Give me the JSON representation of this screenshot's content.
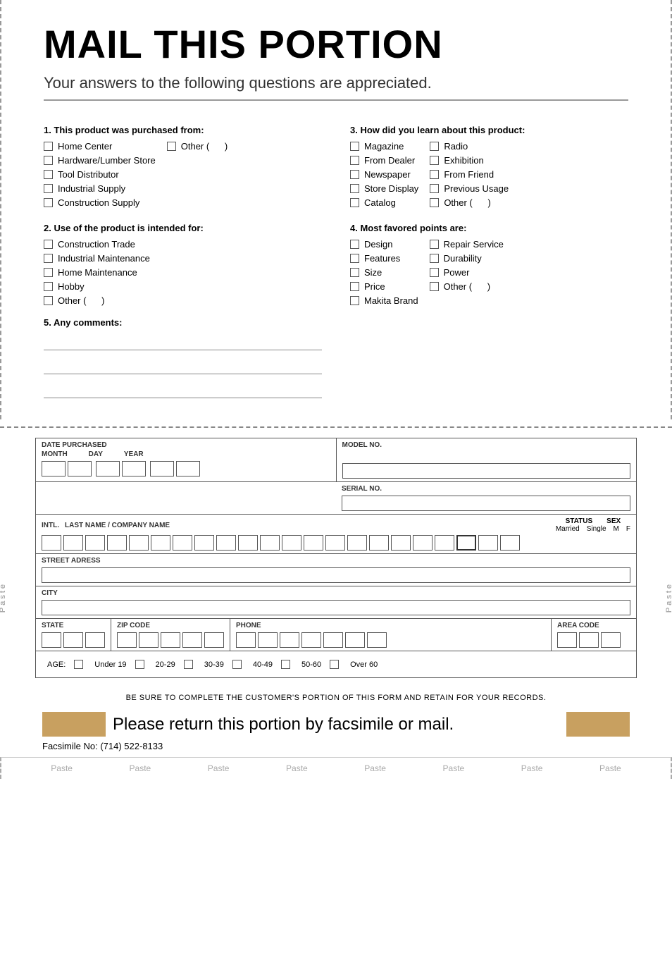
{
  "header": {
    "title": "MAIL THIS PORTION",
    "subtitle": "Your answers to the following questions are appreciated."
  },
  "q1": {
    "label": "1. This product was purchased from:",
    "items": [
      "Home Center",
      "Hardware/Lumber Store",
      "Tool Distributor",
      "Industrial Supply",
      "Construction Supply"
    ],
    "other_label": "Other (",
    "other_close": ")"
  },
  "q2": {
    "label": "2. Use of the product is intended for:",
    "items": [
      "Construction Trade",
      "Industrial Maintenance",
      "Home Maintenance",
      "Hobby",
      "Other ("
    ],
    "other_close": ")"
  },
  "q3": {
    "label": "3. How did you learn about this product:",
    "col1": [
      "Magazine",
      "From Dealer",
      "Newspaper",
      "Store Display",
      "Catalog"
    ],
    "col2": [
      "Radio",
      "Exhibition",
      "From Friend",
      "Previous Usage",
      "Other ("
    ],
    "other_close": ")"
  },
  "q4": {
    "label": "4. Most favored points are:",
    "col1": [
      "Design",
      "Features",
      "Size",
      "Price",
      "Makita Brand"
    ],
    "col2": [
      "Repair Service",
      "Durability",
      "Power",
      "Other ("
    ],
    "other_close": ")"
  },
  "q5": {
    "label": "5. Any comments:"
  },
  "card": {
    "date_purchased": "DATE PURCHASED",
    "month": "MONTH",
    "day": "DAY",
    "year": "YEAR",
    "model_no": "MODEL NO.",
    "serial_no": "SERIAL NO.",
    "intl": "INTL.",
    "last_name": "LAST NAME / COMPANY NAME",
    "status": "STATUS",
    "married": "Married",
    "single": "Single",
    "sex": "SEX",
    "m": "M",
    "f": "F",
    "street": "STREET ADRESS",
    "city": "CITY",
    "state": "STATE",
    "zip": "ZIP CODE",
    "phone": "PHONE",
    "area_code": "AREA CODE",
    "age_label": "AGE:",
    "age_options": [
      "Under 19",
      "20-29",
      "30-39",
      "40-49",
      "50-60",
      "Over 60"
    ]
  },
  "footer": {
    "note": "BE SURE TO COMPLETE THE CUSTOMER'S PORTION OF THIS FORM AND RETAIN FOR YOUR RECORDS.",
    "return_text": "Please return this portion by facsimile or mail.",
    "fax": "Facsimile No: (714) 522-8133"
  },
  "paste_labels": {
    "items": [
      "Paste",
      "Paste",
      "Paste",
      "Paste",
      "Paste",
      "Paste",
      "Paste",
      "Paste"
    ]
  }
}
